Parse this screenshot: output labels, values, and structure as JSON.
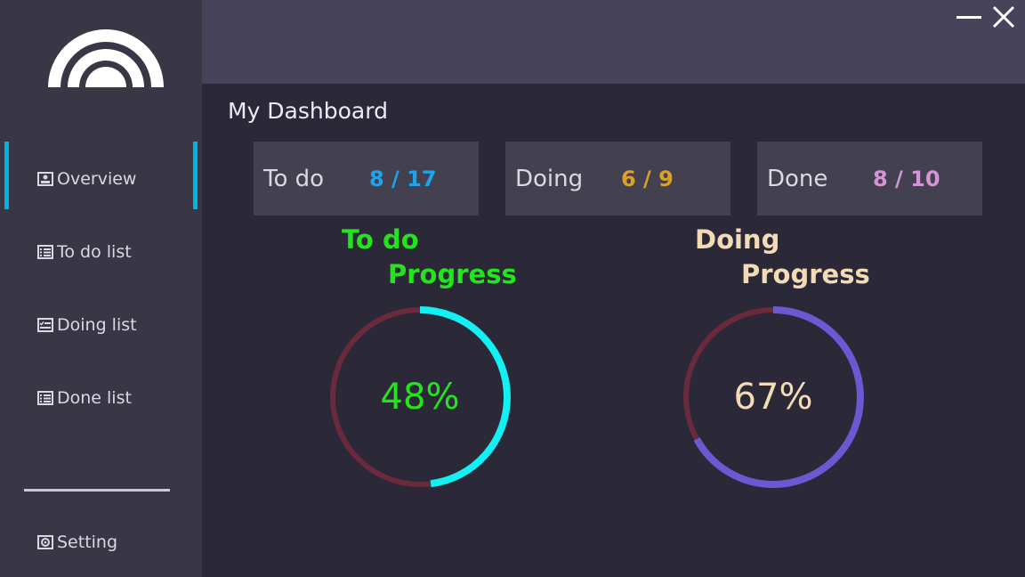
{
  "sidebar": {
    "items": [
      {
        "label": "Overview",
        "icon": "user-card-icon"
      },
      {
        "label": "To do list",
        "icon": "list-icon"
      },
      {
        "label": "Doing list",
        "icon": "checklist-icon"
      },
      {
        "label": "Done list",
        "icon": "list-done-icon"
      }
    ],
    "setting": {
      "label": "Setting",
      "icon": "gear-icon"
    }
  },
  "main": {
    "title": "My Dashboard",
    "cards": [
      {
        "label": "To do",
        "count": "8 / 17",
        "color": "#1fa3ea"
      },
      {
        "label": "Doing",
        "count": "6 / 9",
        "color": "#d8a128"
      },
      {
        "label": "Done",
        "count": "8 / 10",
        "color": "#d494d6"
      }
    ],
    "progress": [
      {
        "line1": "To do",
        "line2": "Progress",
        "percent_label": "48%",
        "value": 0.48,
        "color": "#22e61b",
        "arc_color": "#12f0f4",
        "track_color": "#6a2a3b"
      },
      {
        "line1": "Doing",
        "line2": "Progress",
        "percent_label": "67%",
        "value": 0.67,
        "color": "#f4dbb7",
        "arc_color": "#6d58d3",
        "track_color": "#6a2a3b"
      }
    ]
  }
}
